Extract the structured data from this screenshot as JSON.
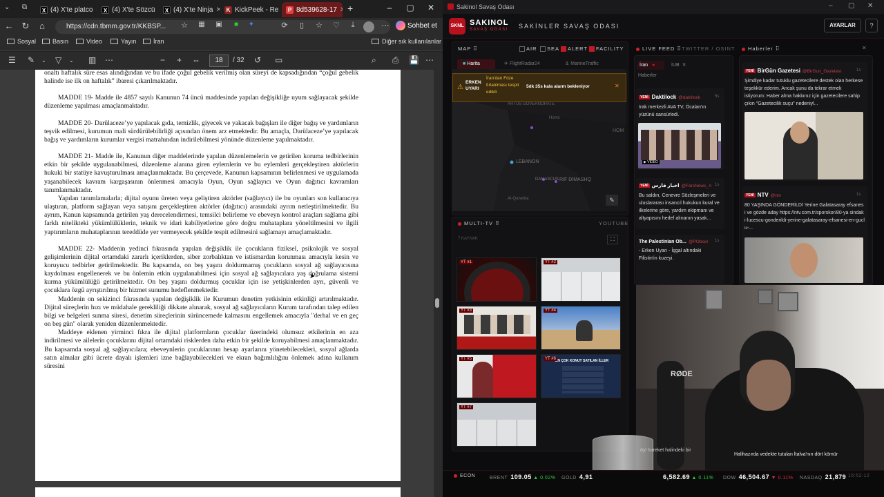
{
  "browser": {
    "tabs": [
      {
        "label": "(4) X'te platco"
      },
      {
        "label": "(4) X'te Sözcü"
      },
      {
        "label": "(4) X'te Ninja"
      },
      {
        "label": "KickPeek - Re"
      },
      {
        "label": "8d539628-17"
      }
    ],
    "url": "https://cdn.tbmm.gov.tr/KKBSP...",
    "chat_label": "Sohbet et",
    "bookmarks": [
      "Sosyal",
      "Basın",
      "Video",
      "Yayın",
      "İran"
    ],
    "other_bookmarks": "Diğer sık kullanılanlar",
    "pdf": {
      "page": "18",
      "total": "/ 32"
    }
  },
  "pdf_text": [
    "onaltı haftalık süre esas alındığından ve bu ifade çoğul gebelik verilmiş olan süreyi de kapsadığından “çoğul gebelik halinde ise ilk on haftalık” ibaresi çıkarılmaktadır.",
    "MADDE 19- Madde ile 4857 sayılı Kanunun 74 üncü maddesinde yapılan değişikliğe uyum sağlayacak şekilde düzenleme yapılması amaçlanmaktadır.",
    "MADDE 20- Darülaceze’ye yapılacak gıda, temizlik, giyecek ve yakacak bağışları ile diğer bağış ve yardımların teşvik edilmesi, kurumun mali sürdürülebilirliği açısından önem arz etmektedir. Bu amaçla, Darülaceze’ye yapılacak bağış ve yardımların kurumlar vergisi matrahından indirilebilmesi yönünde düzenleme yapılmaktadır.",
    "MADDE 21- Madde ile, Kanunun diğer maddelerinde yapılan düzenlemelerin ve getirilen koruma tedbirlerinin etkin bir şekilde uygulanabilmesi, düzenleme alanına giren eylemlerin ve bu eylemleri gerçekleştiren aktörlerin hukuki bir statüye kavuşturulması amaçlanmaktadır. Bu çerçevede, Kanunun kapsamının belirlenmesi ve uygulamada yaşanabilecek kavram kargaşasının önlenmesi amacıyla Oyun, Oyun sağlayıcı ve Oyun dağıtıcı kavramları tanımlanmaktadır.",
    "Yapılan tanımlamalarla; dijital oyunu üreten veya geliştiren aktörler (sağlayıcı) ile bu oyunları son kullanıcıya ulaştıran, platform sağlayan veya satışını gerçekleştiren aktörler (dağıtıcı) arasındaki ayrım netleştirilmektedir. Bu ayrım, Kanun kapsamında getirilen yaş derecelendirmesi, temsilci belirleme ve ebeveyn kontrol araçları sağlama gibi farklı nitelikteki yükümlülüklerin, teknik ve idari kabiliyetlerine göre doğru muhataplara yöneltilmesini ve ilgili yaptırımların muhataplarının tereddüde yer vermeyecek şekilde tespit edilmesini sağlamayı amaçlamaktadır.",
    "MADDE 22- Maddenin yedinci fıkrasında yapılan değişiklik ile çocukların fiziksel, psikolojik ve sosyal gelişimlerinin dijital ortamdaki zararlı içeriklerden, siber zorbalıktan ve istismardan korunması amacıyla kesin ve koruyucu tedbirler getirilmektedir. Bu kapsamda, on beş yaşını doldurmamış çocukların sosyal ağ sağlayıcısına kaydolması engellenerek ve bu önlemin etkin uygulanabilmesi için sosyal ağ sağlayıcılara yaş doğrulama sistemi kurma yükümlülüğü getirilmektedir. On beş yaşını doldurmuş çocuklar için ise yetişkinlerden ayrı, güvenli ve çocuklara özgü ayrıştırılmış bir hizmet sunumu hedeflenmektedir.",
    "Maddenin on sekizinci fıkrasında yapılan değişiklik ile Kurumun denetim yetkisinin etkinliği artırılmaktadır. Dijital süreçlerin hızı ve müdahale gerekliliği dikkate alınarak, sosyal ağ sağlayıcıların Kurum tarafından talep edilen bilgi ve belgeleri sunma süresi, denetim süreçlerinin sürüncemede kalmasını engellemek amacıyla \"derhal ve en geç on beş gün\" olarak yeniden düzenlenmektedir.",
    "Maddeye eklenen yirminci fıkra ile dijital platformların çocuklar üzerindeki olumsuz etkilerinin en aza indirilmesi ve ailelerin çocuklarını dijital ortamdaki risklerden daha etkin bir şekilde koruyabilmesi amaçlanmaktadır. Bu kapsamda sosyal ağ sağlayıcılara; ebeveynlerin çocuklarının hesap ayarlarını yönetebilecekleri, sosyal ağlarda satın almalar gibi ücrete dayalı işlemleri izne bağlayabilecekleri ve ekran bağımlılığını önlemek adına kullanım süresini"
  ],
  "app": {
    "window_title": "Sakinol Savaş Odası",
    "logo_text": "SKNL",
    "brand": "SAKINOL",
    "brand_sub": "SAVAŞ ODASI",
    "header_title": "SAKİNLER SAVAŞ ODASI",
    "settings": "AYARLAR",
    "help": "?",
    "map": {
      "label": "MAP ⠿",
      "toggles": [
        {
          "label": "AIR",
          "on": false
        },
        {
          "label": "SEA",
          "on": false
        },
        {
          "label": "ALERT",
          "on": true
        },
        {
          "label": "FACILITY",
          "on": true
        }
      ],
      "tabs": [
        "Harita",
        "FlightRadar24",
        "MarineTraffic"
      ],
      "alert_tag": "ERKEN UYARI",
      "alert_text": "İran'dan Füze fırlatılması tespit edildi",
      "alert_timer": "5dk 35s kala alarm bekleniyor",
      "places": [
        "ARTUS GOVERNORATE",
        "Homs",
        "LEBANON",
        "DAMASCUS",
        "RIF DIMASHQ",
        "Al-Quneitra",
        "HOM"
      ]
    },
    "live": {
      "label": "LIVE FEED ⠿",
      "sub": "TWITTER / OSINT",
      "tabs": [
        "İran",
        "İUB",
        "Haberler"
      ],
      "cards": [
        {
          "badge": "YENİ",
          "source": "Daktilock",
          "handle": "@daktilock",
          "time": "5s",
          "text": "Irak merkezli AVA TV, Öcalan'ın yüzünü sansürledi.",
          "video_tag": "▶ VIDEO"
        },
        {
          "badge": "YENİ",
          "source": "اخبار فارس",
          "handle": "@FarsNews_A",
          "time": "1s",
          "text": "Bu saldırı, Cenevre Sözleşmeleri ve uluslararası insancıl hukukun kural ve ilkelerine göre, yardım ekipmanı ve altyapısını hedef alınanın yasak..."
        },
        {
          "badge": "",
          "source": "The Palestinian Ob...",
          "handle": "@PObser",
          "time": "1s",
          "text": "- Erken Uyarı - İşgal altındaki Filistin'in kuzeyi."
        }
      ]
    },
    "news": {
      "label": "Haberler ⠿",
      "cards": [
        {
          "badge": "YENİ",
          "source": "BirGün Gazetesi",
          "handle": "@BirGun_Gazetesi",
          "time": "1s",
          "text": "Şimdiye kadar tutuklu gazetecilere destek olan herkese teşekkür ederim. Ancak şunu da tekrar etmek istiyorum: Haber alma hakkınız için gazetecilere sahip çıkın \"Gazetecilik suçu\" nedeniyl..."
        },
        {
          "badge": "YENİ",
          "source": "NTV",
          "handle": "@ntv",
          "time": "1s",
          "text": "80 YAŞINDA GÖNDERİLDİ Yerine Galatasaray efsanesi ve gözde aday https://ntv.com.tr/sporskor/80-ya sindaki-lucescu-gonderildi-yerine-galatasaray-efsanesi-en-guclu-..."
        }
      ],
      "bottom_text": "Halihazırda vedekte tutulan İtalva'nın dört kömür"
    },
    "multitv": {
      "label": "MULTI-TV ⠿",
      "source": "YOUTUBE",
      "sub": "7 KAYNAK",
      "tiles": [
        "YT #1",
        "YT #2",
        "YT #3",
        "YT #4",
        "YT #5",
        "YT #6",
        "YT #7"
      ],
      "tile6_text": "EN ÇOK KONUT SATILAN İLLER"
    },
    "ticker": {
      "label": "ECON",
      "items": [
        {
          "name": "BRENT",
          "value": "109.05",
          "change": "▲ 0.02%",
          "dir": "up"
        },
        {
          "name": "GOLD",
          "value": "4,91",
          "change": "",
          "dir": "up"
        },
        {
          "name": "",
          "value": "6,582.69",
          "change": "▲ 0.11%",
          "dir": "up"
        },
        {
          "name": "DOW",
          "value": "46,504.67",
          "change": "▼ 0.11%",
          "dir": "dn"
        },
        {
          "name": "NASDAQ",
          "value": "21,879",
          "change": "",
          "dir": "up"
        }
      ],
      "time": "16:52:12"
    },
    "overlay_text": "öyl hareket halindeki bir"
  },
  "colors": {
    "accent": "#c41a24",
    "bg": "#0c0c0e",
    "alert": "#3a2a10"
  }
}
